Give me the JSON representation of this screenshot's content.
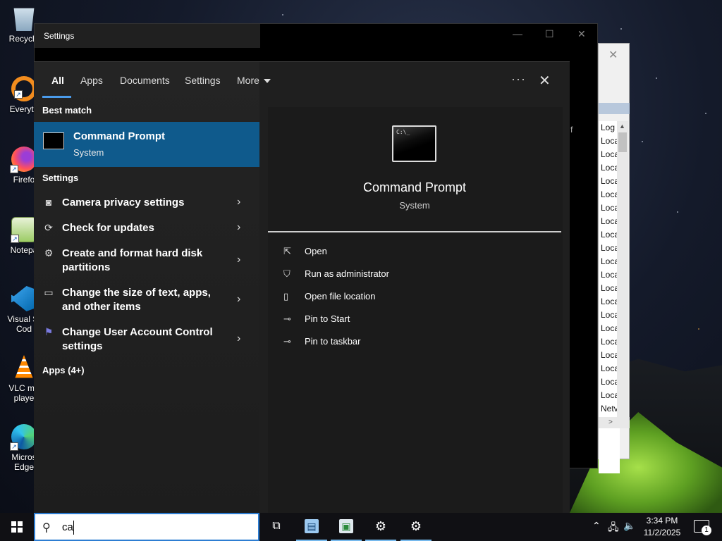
{
  "desktop": {
    "icons": [
      {
        "label": "Recycle",
        "icon": "recycle-bin-icon"
      },
      {
        "label": "Everyth",
        "icon": "everything-search-icon"
      },
      {
        "label": "Firefo",
        "icon": "firefox-icon"
      },
      {
        "label": "Notepa",
        "icon": "notepad-icon"
      },
      {
        "label": "Visual St\nCod",
        "icon": "vscode-icon"
      },
      {
        "label": "VLC me\nplaye",
        "icon": "vlc-icon"
      },
      {
        "label": "Micros\nEdge",
        "icon": "edge-icon"
      }
    ]
  },
  "background_window": {
    "list_items": [
      "Log",
      "Loca",
      "Loca",
      "Loca",
      "Loca",
      "Loca",
      "Loca",
      "Loca",
      "Loca",
      "Loca",
      "Loca",
      "Loca",
      "Loca",
      "Loca",
      "Loca",
      "Loca",
      "Loca",
      "Loca",
      "Loca",
      "Loca",
      "Loca",
      "Netv"
    ],
    "fragment": "f"
  },
  "settings_window": {
    "title": "Settings"
  },
  "search_panel": {
    "tabs": [
      {
        "label": "All",
        "active": true
      },
      {
        "label": "Apps"
      },
      {
        "label": "Documents"
      },
      {
        "label": "Settings"
      },
      {
        "label": "More"
      }
    ],
    "ellipsis": "···",
    "close": "✕",
    "best_match_heading": "Best match",
    "best_match": {
      "name": "Command Prompt",
      "type": "System"
    },
    "settings_heading": "Settings",
    "settings_items": [
      {
        "label": "Camera privacy settings",
        "icon": "camera-icon"
      },
      {
        "label": "Check for updates",
        "icon": "refresh-icon"
      },
      {
        "label": "Create and format hard disk partitions",
        "icon": "disk-management-icon"
      },
      {
        "label": "Change the size of text, apps, and other items",
        "icon": "display-icon"
      },
      {
        "label": "Change User Account Control settings",
        "icon": "uac-flag-icon"
      }
    ],
    "apps_heading": "Apps (4+)",
    "preview": {
      "title": "Command Prompt",
      "subtitle": "System",
      "actions": [
        {
          "label": "Open",
          "icon": "open-icon"
        },
        {
          "label": "Run as administrator",
          "icon": "shield-icon"
        },
        {
          "label": "Open file location",
          "icon": "folder-location-icon"
        },
        {
          "label": "Pin to Start",
          "icon": "pin-icon"
        },
        {
          "label": "Pin to taskbar",
          "icon": "pin-icon"
        }
      ]
    }
  },
  "taskbar": {
    "search_query": "ca",
    "clock_time": "3:34 PM",
    "clock_date": "11/2/2025",
    "notification_count": "1",
    "accent": "#2d7dd2"
  }
}
